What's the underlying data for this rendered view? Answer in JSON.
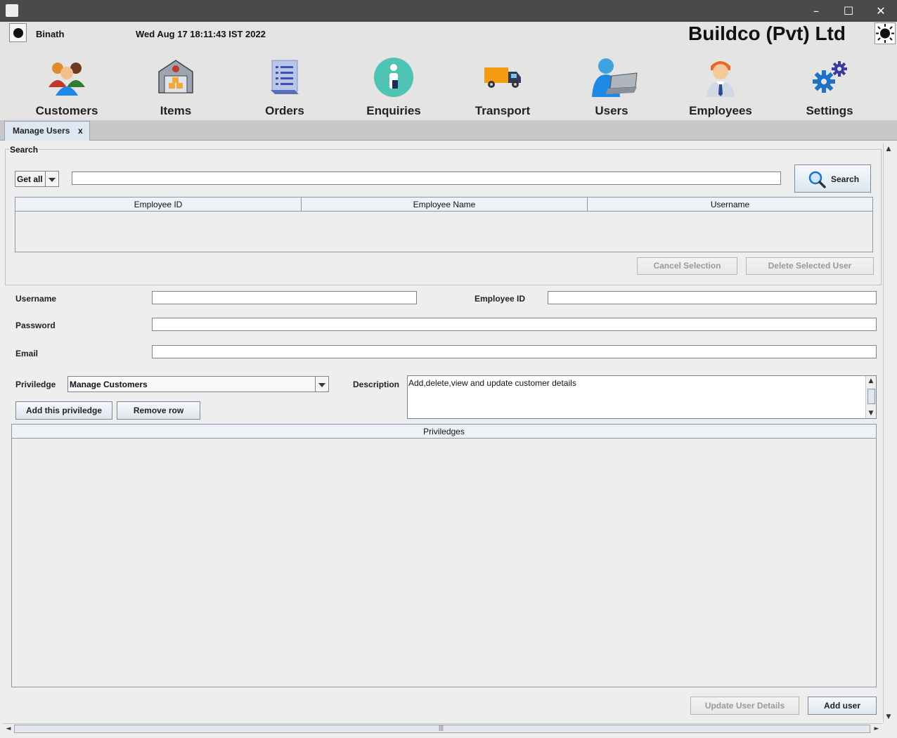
{
  "window": {
    "minimize": "–",
    "maximize": "☐",
    "close": "✕"
  },
  "header": {
    "user_name": "Binath",
    "datetime": "Wed Aug 17 18:11:43 IST 2022",
    "company": "Buildco (Pvt) Ltd"
  },
  "nav": [
    {
      "label": "Customers",
      "icon": "customers-icon"
    },
    {
      "label": "Items",
      "icon": "warehouse-icon"
    },
    {
      "label": "Orders",
      "icon": "orders-icon"
    },
    {
      "label": "Enquiries",
      "icon": "info-icon"
    },
    {
      "label": "Transport",
      "icon": "truck-icon"
    },
    {
      "label": "Users",
      "icon": "users-icon"
    },
    {
      "label": "Employees",
      "icon": "employee-icon"
    },
    {
      "label": "Settings",
      "icon": "gears-icon"
    }
  ],
  "tab": {
    "label": "Manage Users",
    "close": "x"
  },
  "search": {
    "legend": "Search",
    "filter_value": "Get all",
    "query": "",
    "button": "Search",
    "columns": [
      "Employee ID",
      "Employee Name",
      "Username"
    ],
    "cancel_selection": "Cancel Selection",
    "delete_selected": "Delete Selected User"
  },
  "form": {
    "username_label": "Username",
    "employee_id_label": "Employee ID",
    "password_label": "Password",
    "email_label": "Email",
    "privilege_label": "Priviledge",
    "privilege_value": "Manage Customers",
    "description_label": "Description",
    "description_value": "Add,delete,view and update customer details",
    "add_privilege": "Add this priviledge",
    "remove_row": "Remove row",
    "privileges_column": "Priviledges",
    "update_user": "Update User Details",
    "add_user": "Add user"
  },
  "scrollbar": {
    "up": "▲",
    "down": "▼",
    "left": "◄",
    "right": "►",
    "grip": "|||"
  },
  "colors": {
    "accent": "#1e73c8",
    "window_bar": "#4a4a4a"
  }
}
